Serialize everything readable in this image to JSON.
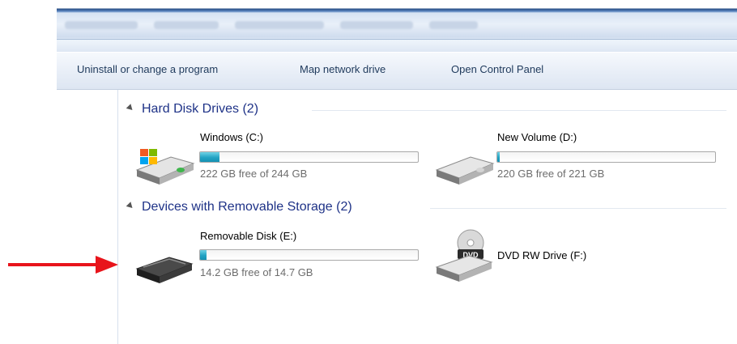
{
  "toolbar": {
    "items": [
      {
        "label": "Uninstall or change a program"
      },
      {
        "label": "Map network drive"
      },
      {
        "label": "Open Control Panel"
      }
    ]
  },
  "groups": [
    {
      "title": "Hard Disk Drives (2)",
      "drives": [
        {
          "name": "Windows (C:)",
          "info": "222 GB free of 244 GB",
          "used_fraction": 0.09,
          "icon": "windows-hard-drive-icon"
        },
        {
          "name": "New Volume (D:)",
          "info": "220 GB free of 221 GB",
          "used_fraction": 0.005,
          "icon": "hard-drive-icon"
        }
      ]
    },
    {
      "title": "Devices with Removable Storage (2)",
      "drives": [
        {
          "name": "Removable Disk (E:)",
          "info": "14.2 GB free of 14.7 GB",
          "used_fraction": 0.03,
          "icon": "removable-disk-icon"
        },
        {
          "name": "DVD RW Drive (F:)",
          "icon": "dvd-drive-icon",
          "icon_text": "DVD"
        }
      ]
    }
  ],
  "colors": {
    "group_title": "#1e3287",
    "toolbar_text": "#1e395b",
    "bar_fill": "#22a3c3",
    "arrow": "#e8141b"
  },
  "annotation": {
    "icon": "red-arrow-icon"
  }
}
